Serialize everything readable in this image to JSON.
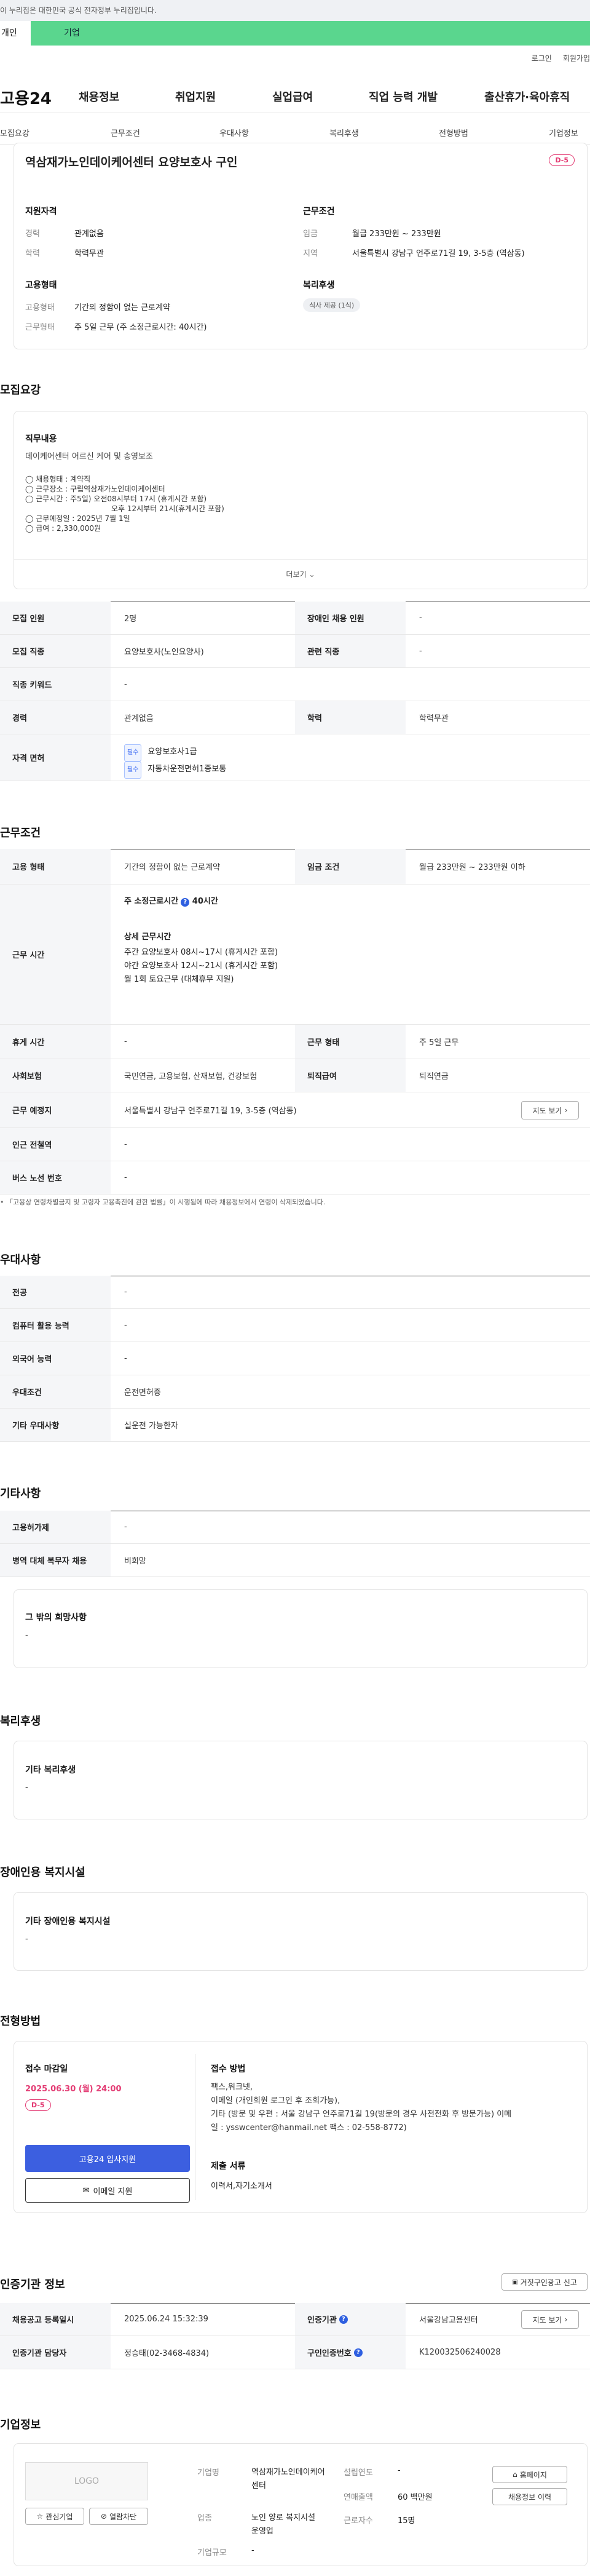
{
  "gov_banner": "이 누리집은 대한민국 공식 전자정부 누리집입니다.",
  "tabs": {
    "personal": "개인",
    "company": "기업"
  },
  "util": {
    "login": "로그인",
    "join": "회원가입"
  },
  "gnb": {
    "logo": "고용24",
    "menu": [
      "채용정보",
      "취업지원",
      "실업급여",
      "직업 능력 개발",
      "출산휴가·육아휴직"
    ]
  },
  "anchors": [
    "모집요강",
    "근무조건",
    "우대사항",
    "복리후생",
    "전형방법",
    "기업정보"
  ],
  "summary": {
    "title": "역삼재가노인데이케어센터 요양보호사 구인",
    "dday": "D-5",
    "qual": {
      "heading": "지원자격",
      "career_label": "경력",
      "career": "관계없음",
      "edu_label": "학력",
      "edu": "학력무관"
    },
    "cond": {
      "heading": "근무조건",
      "wage_label": "임금",
      "wage": "월급 233만원 ~ 233만원",
      "loc_label": "지역",
      "loc": "서울특별시 강남구 언주로71길 19, 3-5층 (역삼동)"
    },
    "emp": {
      "heading": "고용형태",
      "type_label": "고용형태",
      "type": "기간의 정함이 없는 근로계약",
      "hours_label": "근무형태",
      "hours": "주 5일 근무 (주 소정근로시간: 40시간)"
    },
    "welfare": {
      "heading": "복리후생",
      "tag": "식사 제공 (1식)"
    }
  },
  "recruit": {
    "heading": "모집요강",
    "duty_heading": "직무내용",
    "duty_desc": "데이케어센터 어르신 케어 및 송영보조",
    "lines": [
      "◯ 채용형태 : 계약직",
      "◯ 근무장소 : 구립역삼재가노인데이케어센터",
      "◯ 근무시간 : 주5일)  오전08시부터 17시 (휴게시간 포함)",
      "오후 12시부터 21시(휴게시간 포함)",
      "◯ 근무예정일 : 2025년 7월 1일",
      "◯ 급여 : 2,330,000원"
    ],
    "more": "더보기"
  },
  "recruit_table": {
    "count_label": "모집 인원",
    "count": "2명",
    "disabled_label": "장애인 채용 인원",
    "disabled": "-",
    "job_label": "모집 직종",
    "job": "요양보호사(노인요양사)",
    "related_label": "관련 직종",
    "related": "-",
    "keyword_label": "직종 키워드",
    "keyword": "-",
    "career_label": "경력",
    "career": "관계없음",
    "edu_label": "학력",
    "edu": "학력무관",
    "license_label": "자격 면허",
    "badge": "필수",
    "licenses": [
      "요양보호사1급",
      "자동차운전면허1종보통"
    ]
  },
  "work": {
    "heading": "근무조건",
    "emptype_label": "고용 형태",
    "emptype": "기간의 정함이 없는 근로계약",
    "wage_label": "임금 조건",
    "wage": "월급 233만원 ~ 233만원 이하",
    "time_label": "근무 시간",
    "weekly": "주 소정근로시간",
    "weekly_val": "40시간",
    "detail_heading": "상세 근무시간",
    "details": [
      "주간 요양보호사 08시~17시 (휴게시간 포함)",
      "야간 요양보호사 12시~21시 (휴게시간 포함)",
      "월 1회 토요근무 (대체휴무 지원)"
    ],
    "break_label": "휴게 시간",
    "break": "-",
    "form_label": "근무 형태",
    "form": "주 5일 근무",
    "ins_label": "사회보험",
    "ins": "국민연금, 고용보험, 산재보험, 건강보험",
    "sev_label": "퇴직급여",
    "sev": "퇴직연금",
    "loc_label": "근무 예정지",
    "loc": "서울특별시 강남구 언주로71길 19, 3-5층 (역삼동)",
    "map": "지도 보기",
    "station_label": "인근 전철역",
    "station": "-",
    "bus_label": "버스 노선 번호",
    "bus": "-",
    "note": "「고용상 연령차별금지 및 고령자 고용촉진에 관한 법률」이 시행됨에 따라 채용정보에서 연령이 삭제되었습니다."
  },
  "pref": {
    "heading": "우대사항",
    "major_label": "전공",
    "major": "-",
    "pc_label": "컴퓨터 활용 능력",
    "pc": "-",
    "lang_label": "외국어 능력",
    "lang": "-",
    "cond_label": "우대조건",
    "cond": "운전면허증",
    "etc_label": "기타 우대사항",
    "etc": "실운전 가능한자"
  },
  "etc": {
    "heading": "기타사항",
    "welfare_label": "고용허가제",
    "welfare": "-",
    "army_label": "병역 대체 복무자 채용",
    "army": "비희망",
    "other_heading": "그 밖의 희망사항",
    "other": "-"
  },
  "benefit": {
    "heading": "복리후생",
    "sub": "기타 복리후생",
    "val": "-"
  },
  "disabled_fac": {
    "heading": "장애인용 복지시설",
    "sub": "기타 장애인용 복지시설",
    "val": "-"
  },
  "selection": {
    "heading": "전형방법",
    "deadline_label": "접수 마감일",
    "deadline": "2025.06.30 (월) 24:00",
    "dday": "D-5",
    "apply": "고용24 입사지원",
    "email": "이메일 지원",
    "method_heading": "접수 방법",
    "methods": [
      "팩스,워크넷,",
      "이메일 (개인회원 로그인 후 조회가능),",
      "기타 (방문 및 우편 : 서울 강남구 언주로71길 19(방문의 경우 사전전화 후 방문가능) 이메",
      "일 : ysswcenter@hanmail.net 팩스 : 02-558-8772)"
    ],
    "docs_heading": "제출 서류",
    "docs": "이력서,자기소개서"
  },
  "auth": {
    "heading": "인증기관 정보",
    "report": "거짓구인광고 신고",
    "reg_label": "채용공고 등록일시",
    "reg": "2025.06.24 15:32:39",
    "org_label": "인증기관",
    "org": "서울강남고용센터",
    "map": "지도 보기",
    "mgr_label": "인증기관 담당자",
    "mgr": "정승태(02-3468-4834)",
    "no_label": "구인인증번호",
    "no": "K120032506240028"
  },
  "company": {
    "heading": "기업정보",
    "logo": "LOGO",
    "fav": "관심기업",
    "block": "열람차단",
    "name_label": "기업명",
    "name": "역삼재가노인데이케어센터",
    "year_label": "설립연도",
    "year": "-",
    "sales_label": "연매출액",
    "sales": "60 백만원",
    "ind_label": "업종",
    "ind": "노인 양로 복지시설 운영업",
    "emp_label": "근로자수",
    "emp": "15명",
    "scale_label": "기업규모",
    "scale": "-",
    "home": "홈페이지",
    "jobs": "채용정보 이력"
  }
}
